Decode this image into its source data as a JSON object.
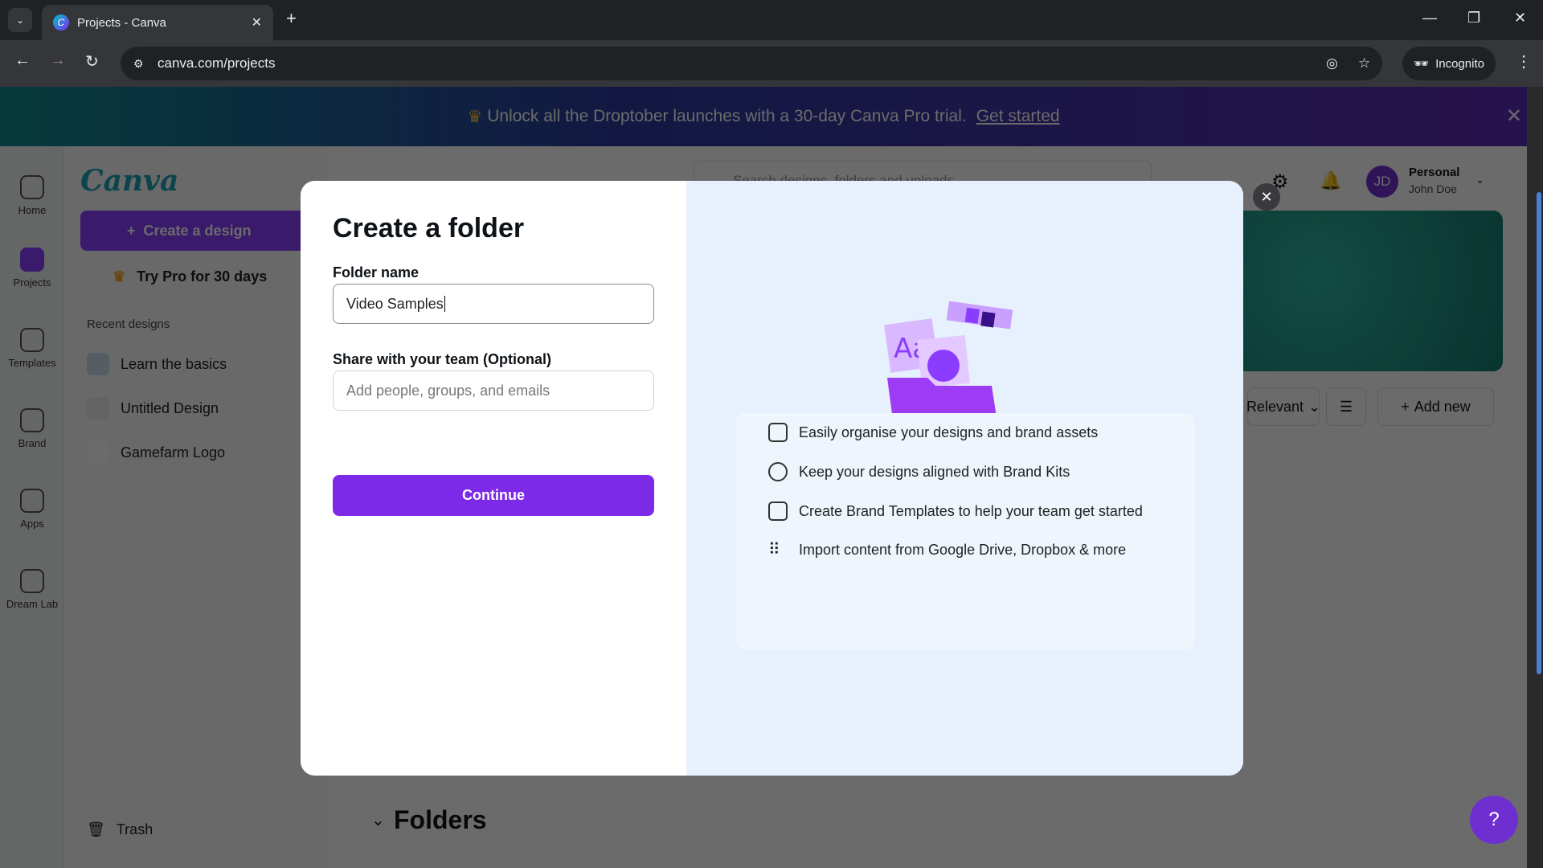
{
  "browser": {
    "tab_title": "Projects - Canva",
    "url": "canva.com/projects",
    "incognito_label": "Incognito"
  },
  "banner": {
    "text": "Unlock all the Droptober launches with a 30-day Canva Pro trial.",
    "link": "Get started"
  },
  "rail": {
    "items": [
      {
        "label": "Home"
      },
      {
        "label": "Projects"
      },
      {
        "label": "Templates"
      },
      {
        "label": "Brand"
      },
      {
        "label": "Apps"
      },
      {
        "label": "Dream Lab"
      }
    ]
  },
  "panel": {
    "logo": "Canva",
    "create_label": "Create a design",
    "pro_label": "Try Pro for 30 days",
    "recent_heading": "Recent designs",
    "recent": [
      {
        "label": "Learn the basics"
      },
      {
        "label": "Untitled Design"
      },
      {
        "label": "Gamefarm Logo"
      }
    ],
    "trash_label": "Trash"
  },
  "header": {
    "search_placeholder": "Search designs, folders and uploads",
    "account_type": "Personal",
    "user_name": "John Doe",
    "avatar_initials": "JD"
  },
  "toolbar": {
    "sort_label": "Relevant",
    "add_new_label": "Add new"
  },
  "main": {
    "folders_heading": "Folders",
    "help": "?"
  },
  "modal": {
    "title": "Create a folder",
    "folder_name_label": "Folder name",
    "folder_name_value": "Video Samples",
    "share_label": "Share with your team (Optional)",
    "share_placeholder": "Add people, groups, and emails",
    "continue_label": "Continue",
    "features": [
      {
        "icon": "folder-settings-icon",
        "text": "Easily organise your designs and brand assets"
      },
      {
        "icon": "brand-kit-icon",
        "text": "Keep your designs aligned with Brand Kits"
      },
      {
        "icon": "template-icon",
        "text": "Create Brand Templates to help your team get started"
      },
      {
        "icon": "apps-grid-icon",
        "text": "Import content from Google Drive, Dropbox & more"
      }
    ]
  },
  "colors": {
    "accent": "#7d2ae8",
    "modal_right_bg": "#e6f1fd"
  }
}
